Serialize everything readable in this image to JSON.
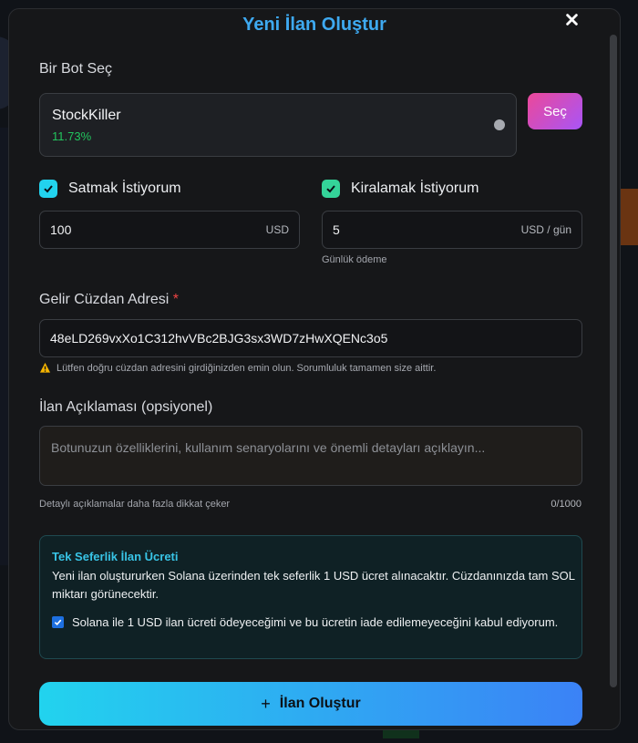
{
  "modal": {
    "title": "Yeni İlan Oluştur",
    "close_icon": "close-icon"
  },
  "bot": {
    "section_label": "Bir Bot Seç",
    "name": "StockKiller",
    "percent": "11.73%",
    "select_button": "Seç"
  },
  "sell": {
    "label": "Satmak İstiyorum",
    "checked": true,
    "value": "100",
    "unit": "USD"
  },
  "rent": {
    "label": "Kiralamak İstiyorum",
    "checked": true,
    "value": "5",
    "unit": "USD / gün",
    "hint": "Günlük ödeme"
  },
  "wallet": {
    "label": "Gelir Cüzdan Adresi",
    "required_mark": "*",
    "value": "48eLD269vxXo1C312hvVBc2BJG3sx3WD7zHwXQENc3o5",
    "warning": "Lütfen doğru cüzdan adresini girdiğinizden emin olun. Sorumluluk tamamen size aittir."
  },
  "description": {
    "label": "İlan Açıklaması (opsiyonel)",
    "placeholder": "Botunuzun özelliklerini, kullanım senaryolarını ve önemli detayları açıklayın...",
    "hint": "Detaylı açıklamalar daha fazla dikkat çeker",
    "counter": "0/1000"
  },
  "fee": {
    "title": "Tek Seferlik İlan Ücreti",
    "text": "Yeni ilan oluştururken Solana üzerinden tek seferlik 1 USD ücret alınacaktır. Cüzdanınızda tam SOL miktarı görünecektir.",
    "consent": "Solana ile 1 USD ilan ücreti ödeyeceğimi ve bu ücretin iade edilemeyeceğini kabul ediyorum.",
    "consent_checked": true
  },
  "submit": {
    "icon": "plus-icon",
    "label": "İlan Oluştur"
  },
  "colors": {
    "title": "#3ea9f0",
    "select_gradient_start": "#ec4899",
    "select_gradient_end": "#a855f7",
    "submit_gradient_start": "#22d3ee",
    "submit_gradient_end": "#3b82f6",
    "percent_green": "#22c55e"
  }
}
